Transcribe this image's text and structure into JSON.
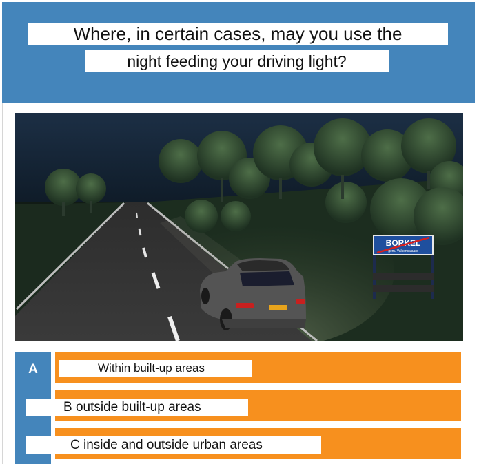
{
  "question": {
    "line1": "Where, in certain cases, may you use the",
    "line2": "night feeding your driving light?"
  },
  "image": {
    "sign_name": "BORKEL",
    "sign_sub": "gem. Valkenswaard"
  },
  "answers": [
    {
      "letter": "A",
      "text": "Within built-up areas"
    },
    {
      "text": "B outside built-up areas"
    },
    {
      "text": "C inside and outside urban areas"
    }
  ],
  "colors": {
    "header_blue": "#4485bb",
    "answer_orange": "#f7901e"
  }
}
